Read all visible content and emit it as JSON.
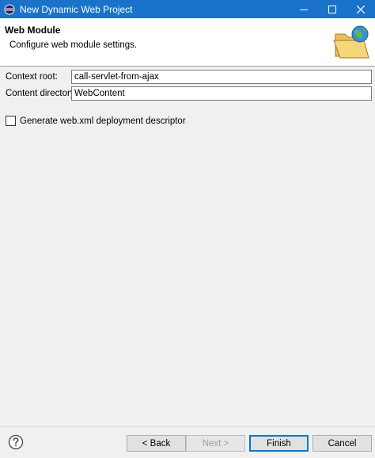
{
  "window": {
    "title": "New Dynamic Web Project",
    "colors": {
      "titlebar": "#1a73c9",
      "accent": "#0078d7"
    }
  },
  "header": {
    "title": "Web Module",
    "description": "Configure web module settings.",
    "icon": "folder-globe-icon"
  },
  "form": {
    "context_root": {
      "label": "Context root:",
      "value": "call-servlet-from-ajax"
    },
    "content_directory": {
      "label": "Content directory:",
      "value": "WebContent"
    },
    "generate_webxml": {
      "label": "Generate web.xml deployment descriptor",
      "checked": false
    }
  },
  "footer": {
    "help_icon": "help-icon",
    "back_label": "< Back",
    "next_label": "Next >",
    "finish_label": "Finish",
    "cancel_label": "Cancel"
  }
}
